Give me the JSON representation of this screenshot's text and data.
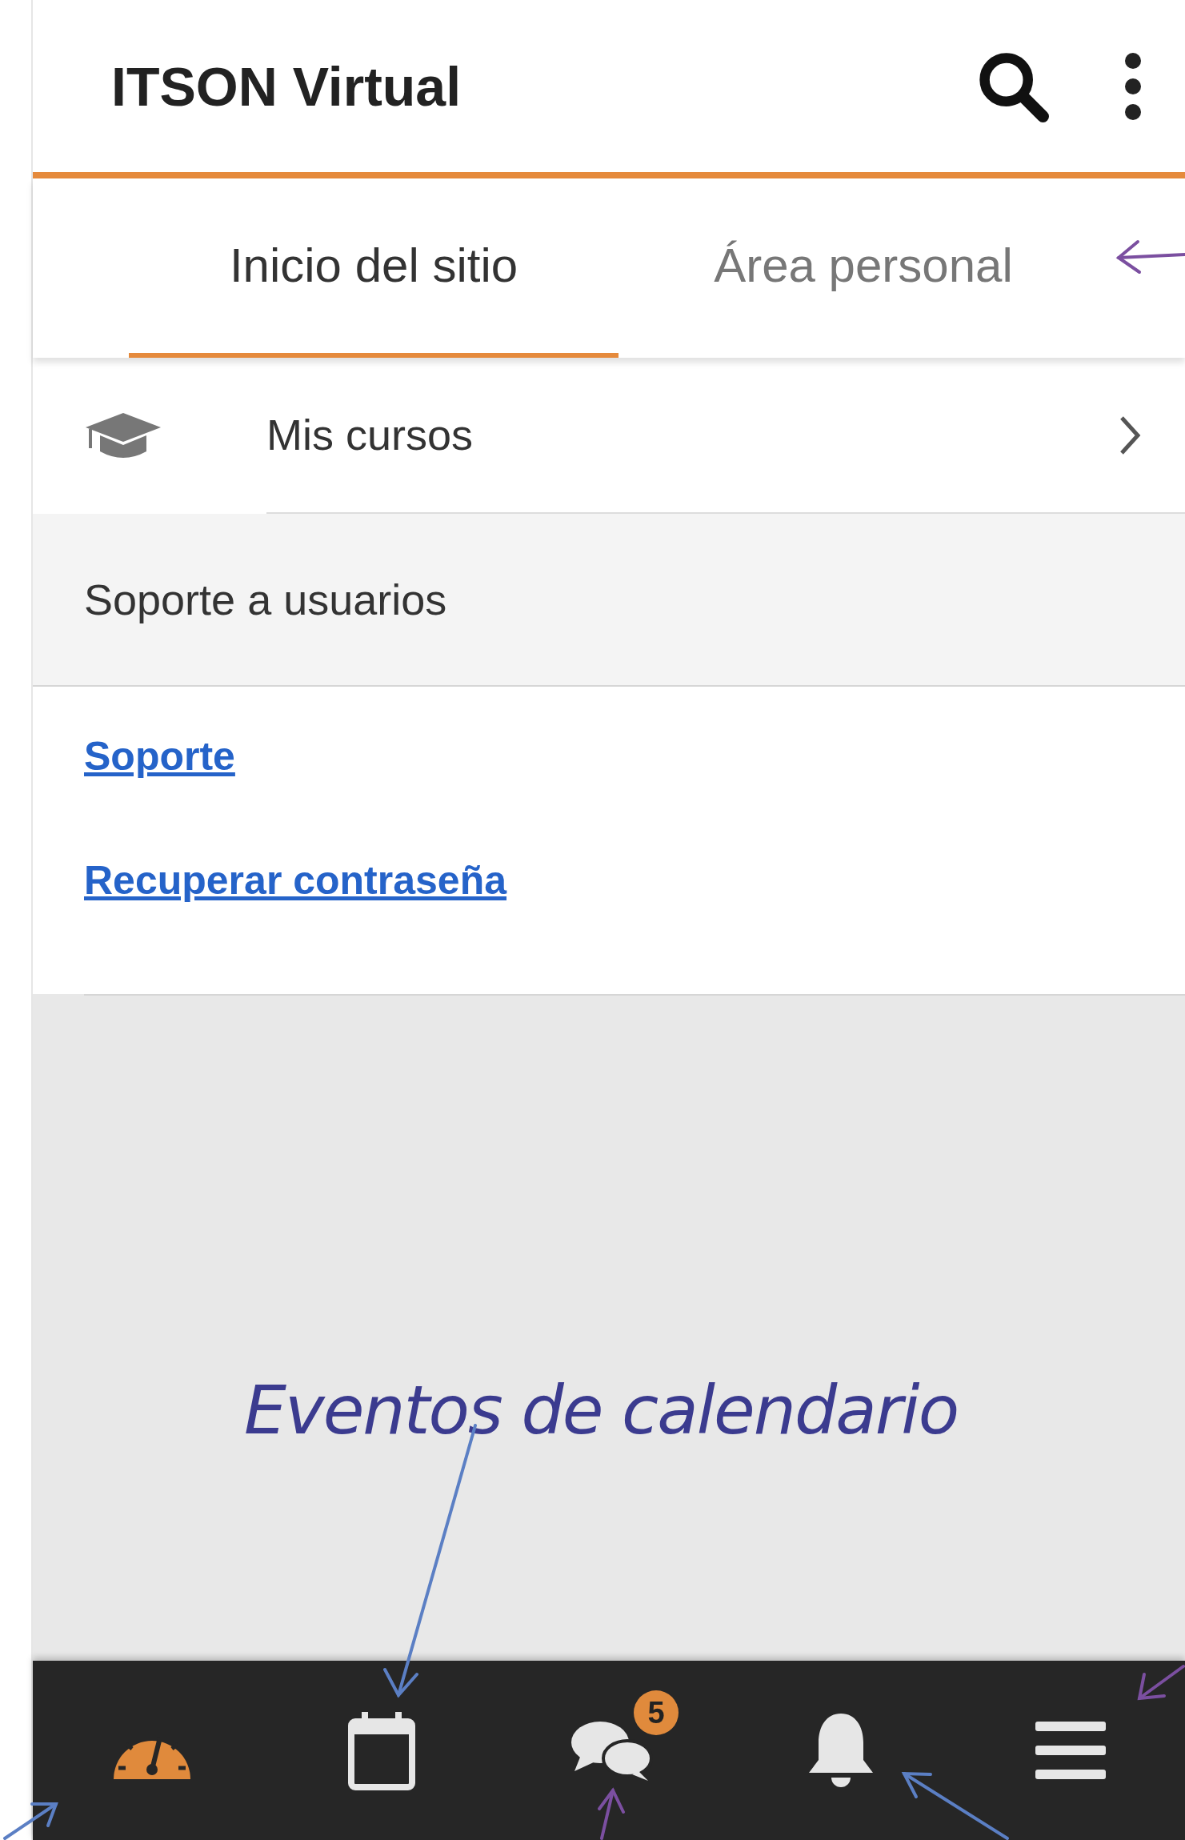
{
  "app_bar": {
    "title": "ITSON Virtual"
  },
  "tabs": [
    {
      "label": "Inicio del sitio",
      "selected": true
    },
    {
      "label": "Área personal",
      "selected": false
    }
  ],
  "menu_items": [
    {
      "label": "Mis cursos"
    }
  ],
  "section": {
    "title": "Soporte a usuarios",
    "links": [
      "Soporte",
      "Recuperar contraseña"
    ]
  },
  "annotation": {
    "label": "Eventos de calendario"
  },
  "bottom_nav": [
    {
      "kind": "dashboard"
    },
    {
      "kind": "calendar"
    },
    {
      "kind": "messages",
      "badge": "5"
    },
    {
      "kind": "notifications"
    },
    {
      "kind": "menu"
    }
  ]
}
